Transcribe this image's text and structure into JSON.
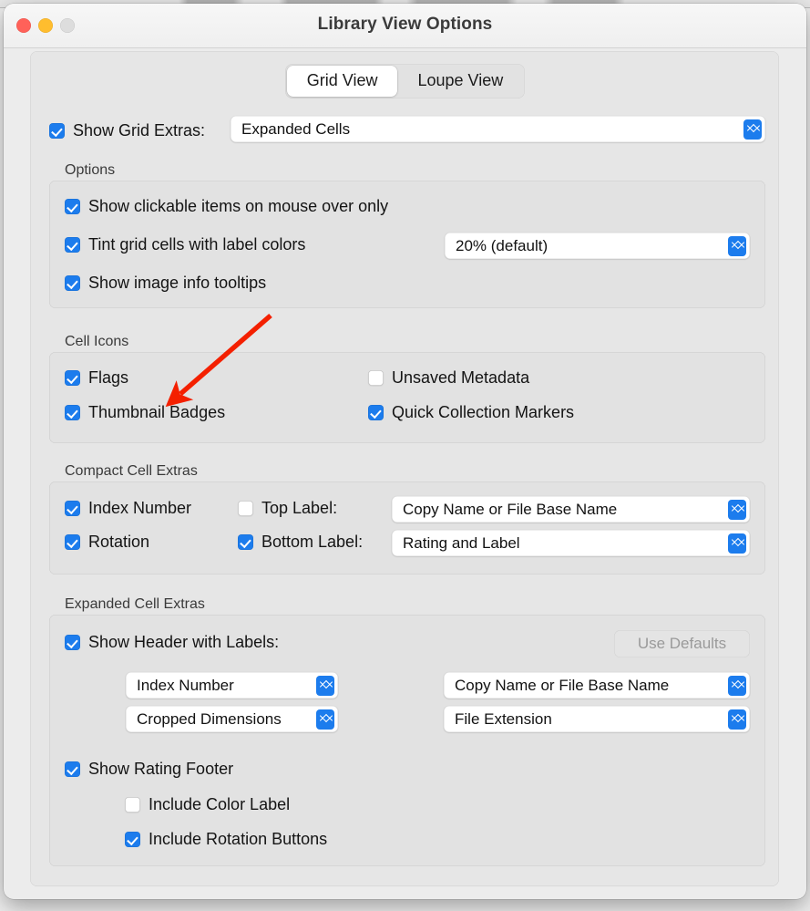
{
  "window": {
    "title": "Library View Options",
    "traffic_lights": [
      "close",
      "minimize",
      "zoom"
    ]
  },
  "tabs": [
    {
      "label": "Grid View",
      "selected": true
    },
    {
      "label": "Loupe View",
      "selected": false
    }
  ],
  "top_row": {
    "checkbox": {
      "label": "Show Grid Extras:",
      "checked": true
    },
    "popup_value": "Expanded Cells"
  },
  "options_group": {
    "title": "Options",
    "items": [
      {
        "label": "Show clickable items on mouse over only",
        "checked": true
      },
      {
        "label": "Tint grid cells with label colors",
        "checked": true
      },
      {
        "label": "Show image info tooltips",
        "checked": true
      }
    ],
    "tint_popup_value": "20% (default)"
  },
  "cell_icons_group": {
    "title": "Cell Icons",
    "items": [
      {
        "label": "Flags",
        "checked": true
      },
      {
        "label": "Unsaved Metadata",
        "checked": false
      },
      {
        "label": "Thumbnail Badges",
        "checked": true
      },
      {
        "label": "Quick Collection Markers",
        "checked": true
      }
    ]
  },
  "compact_cell_group": {
    "title": "Compact Cell Extras",
    "items": [
      {
        "label": "Index Number",
        "checked": true
      },
      {
        "label": "Top Label:",
        "checked": false
      },
      {
        "label": "Rotation",
        "checked": true
      },
      {
        "label": "Bottom Label:",
        "checked": true
      }
    ],
    "top_label_popup": "Copy Name or File Base Name",
    "bottom_label_popup": "Rating and Label"
  },
  "expanded_cell_group": {
    "title": "Expanded Cell Extras",
    "show_header_checkbox": {
      "label": "Show Header with Labels:",
      "checked": true
    },
    "use_defaults_button": {
      "label": "Use Defaults",
      "enabled": false
    },
    "popups": [
      "Index Number",
      "Copy Name or File Base Name",
      "Cropped Dimensions",
      "File Extension"
    ],
    "rating_footer": {
      "label": "Show Rating Footer",
      "checked": true
    },
    "sub_items": [
      {
        "label": "Include Color Label",
        "checked": false
      },
      {
        "label": "Include Rotation Buttons",
        "checked": true
      }
    ]
  },
  "annotation": {
    "arrow_color": "#f42000"
  }
}
